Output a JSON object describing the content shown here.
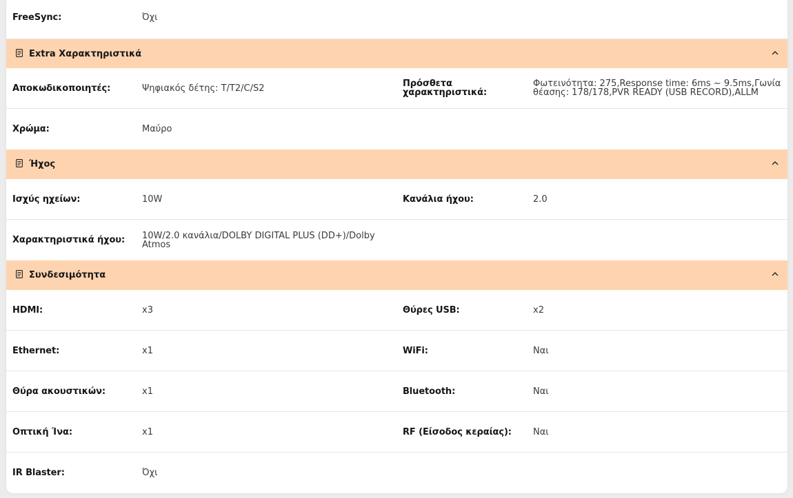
{
  "top_row": {
    "label": "FreeSync:",
    "value": "Όχι"
  },
  "sections": [
    {
      "title": "Extra Χαρακτηριστικά",
      "rows": [
        {
          "l1": "Αποκωδικοποιητές:",
          "v1": "Ψηφιακός δέτης: T/T2/C/S2",
          "l2": "Πρόσθετα χαρακτηριστικά:",
          "v2": "Φωτεινότητα: 275,Response time: 6ms ~ 9.5ms,Γωνία θέασης: 178/178,PVR READY (USB RECORD),ALLM"
        },
        {
          "l1": "Χρώμα:",
          "v1": "Μαύρο",
          "l2": "",
          "v2": ""
        }
      ]
    },
    {
      "title": "Ήχος",
      "rows": [
        {
          "l1": "Ισχύς ηχείων:",
          "v1": "10W",
          "l2": "Κανάλια ήχου:",
          "v2": "2.0"
        },
        {
          "l1": "Χαρακτηριστικά ήχου:",
          "v1": "10W/2.0 κανάλια/DOLBY DIGITAL PLUS (DD+)/Dolby Atmos",
          "l2": "",
          "v2": ""
        }
      ]
    },
    {
      "title": "Συνδεσιμότητα",
      "rows": [
        {
          "l1": "HDMI:",
          "v1": "x3",
          "l2": "Θύρες USB:",
          "v2": "x2"
        },
        {
          "l1": "Ethernet:",
          "v1": "x1",
          "l2": "WiFi:",
          "v2": "Ναι"
        },
        {
          "l1": "Θύρα ακουστικών:",
          "v1": "x1",
          "l2": "Bluetooth:",
          "v2": "Ναι"
        },
        {
          "l1": "Οπτική Ίνα:",
          "v1": "x1",
          "l2": "RF (Είσοδος κεραίας):",
          "v2": "Ναι"
        },
        {
          "l1": "IR Blaster:",
          "v1": "Όχι",
          "l2": "",
          "v2": ""
        }
      ]
    }
  ],
  "icons": {
    "section": "document-icon",
    "toggle": "chevron-up-icon"
  },
  "colors": {
    "section_bg": "#fed4b0",
    "divider": "#e6e6e6"
  }
}
